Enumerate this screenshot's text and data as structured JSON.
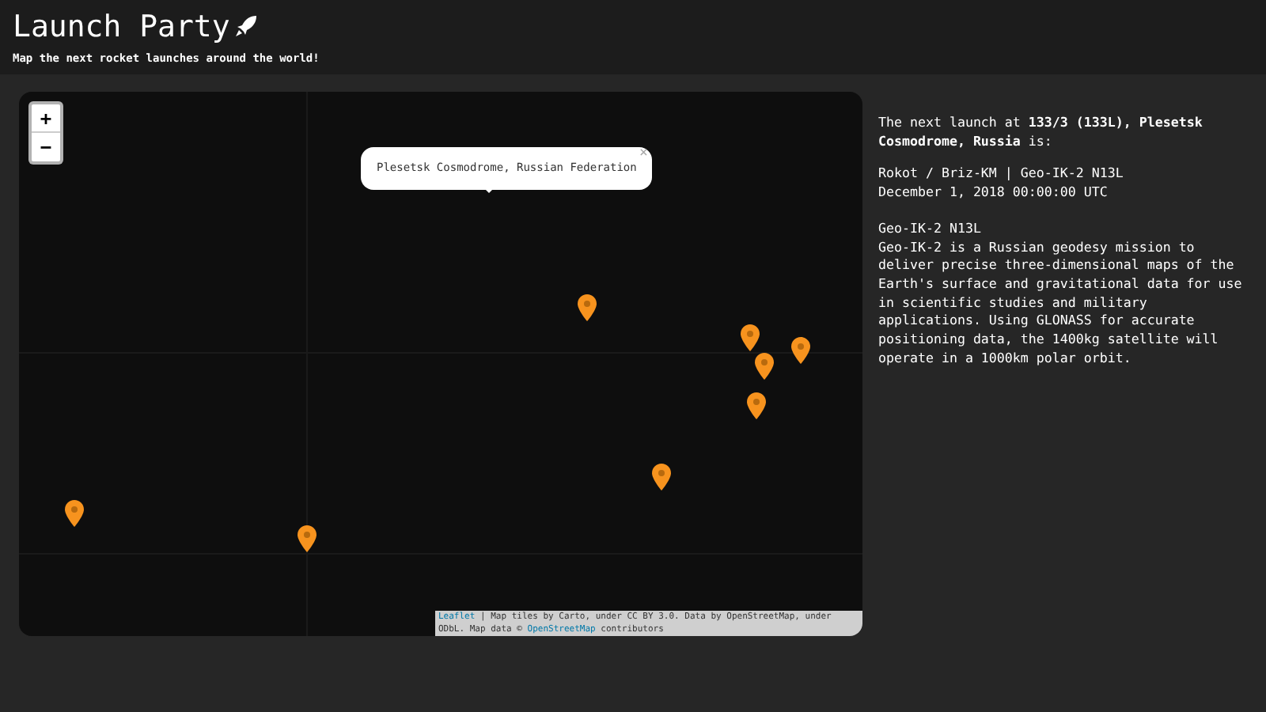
{
  "header": {
    "title": "Launch Party",
    "subtitle": "Map the next rocket launches around the world!"
  },
  "map": {
    "zoom_in": "+",
    "zoom_out": "−",
    "popup": {
      "text": "Plesetsk Cosmodrome, Russian Federation",
      "close": "×"
    },
    "attribution": {
      "leaflet_link": "Leaflet",
      "text_1": " | Map tiles by Carto, under CC BY 3.0. Data by OpenStreetMap, under ODbL. Map data © ",
      "osm_link": "OpenStreetMap",
      "text_2": " contributors"
    }
  },
  "info": {
    "intro": "The next launch at **133/3 (133L), Plesetsk Cosmodrome, Russia** is:",
    "vehicle": "Rokot / Briz-KM | Geo-IK-2 N13L",
    "date": "December 1, 2018 00:00:00 UTC",
    "mission_name": "Geo-IK-2 N13L",
    "description": "Geo-IK-2 is a Russian geodesy mission to deliver precise three-dimensional maps of the Earth's surface and gravitational data for use in scientific studies and military applications. Using GLONASS for accurate positioning data, the 1400kg satellite will operate in a 1000km polar orbit."
  }
}
